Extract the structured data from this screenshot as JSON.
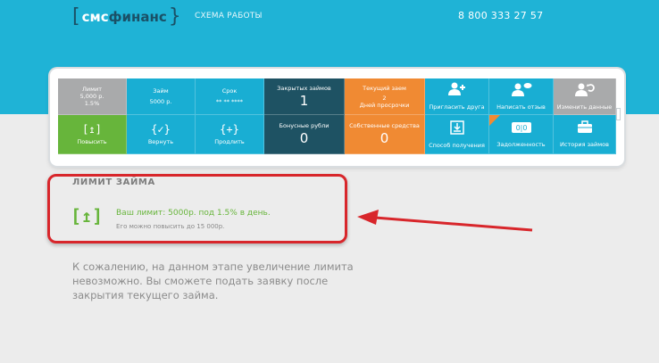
{
  "header": {
    "logo_bracket_left": "[",
    "logo_sms": "смс",
    "logo_finance": "финанс",
    "logo_bracket_right": "}",
    "nav_link": "СХЕМА РАБОТЫ",
    "phone": "8 800 333 27 57"
  },
  "dashboard": {
    "limit": {
      "label": "Лимит",
      "amount": "5,000 р.",
      "rate": "1.5%"
    },
    "loan": {
      "label": "Займ",
      "amount": "5000 р."
    },
    "term": {
      "label": "Срок",
      "value": "** ** ****"
    },
    "closed_loans": {
      "label": "Закрытых займов",
      "value": "1"
    },
    "current_loan": {
      "label": "Текущий заем",
      "value": "2",
      "note": "Дней просрочки"
    },
    "invite_friend": {
      "label": "Пригласить друга",
      "icon": "user-plus-icon"
    },
    "write_review": {
      "label": "Написать отзыв",
      "icon": "user-comment-icon"
    },
    "change_data": {
      "label": "Изменить данные",
      "icon": "user-refresh-icon"
    },
    "raise": {
      "label": "Повысить",
      "icon": "[↥]"
    },
    "return": {
      "label": "Вернуть",
      "icon": "{✓}"
    },
    "extend": {
      "label": "Продлить",
      "icon": "{+}"
    },
    "bonus": {
      "label": "Бонусные рубли",
      "value": "0"
    },
    "own_funds": {
      "label": "Собственные средства",
      "value": "0"
    },
    "receive_method": {
      "label": "Способ получения",
      "icon": "download-icon"
    },
    "debt": {
      "label": "Задолженность",
      "icon": "counter-icon",
      "counter": "0|0"
    },
    "history": {
      "label": "История займов",
      "icon": "briefcase-icon"
    }
  },
  "limit_section": {
    "title": "ЛИМИТ ЗАЙМА",
    "icon": "[↥]",
    "limit_text": "Ваш лимит: 5000р. под  1.5% в день.",
    "raise_hint": "Его можно повысить до 15 000р."
  },
  "notice": "К сожалению, на данном этапе увеличение лимита невозможно. Вы сможете подать заявку после закрытия текущего займа.",
  "colors": {
    "brand_cyan": "#1fb3d6",
    "dark_tile": "#1e5263",
    "orange_tile": "#f08a33",
    "green_tile": "#67b53b",
    "annotation_red": "#d8262b"
  }
}
